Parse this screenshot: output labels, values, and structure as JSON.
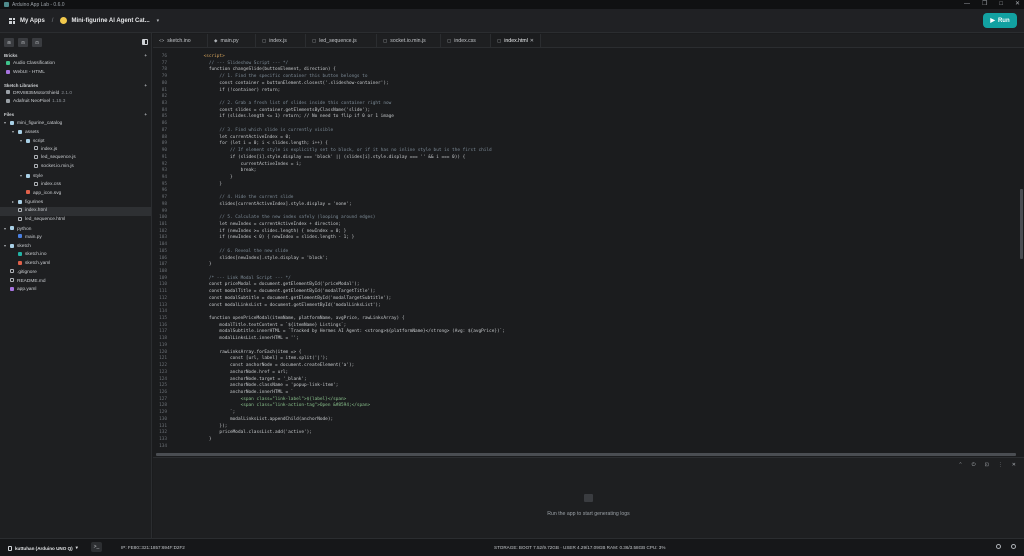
{
  "window": {
    "title": "Arduino App Lab - 0.6.0",
    "controls": [
      "—",
      "❐",
      "□",
      "✕"
    ]
  },
  "header": {
    "my_apps": "My Apps",
    "separator": "/",
    "app_name": "Mini-figurine AI Agent Cat...",
    "run_label": "Run"
  },
  "sidebar": {
    "tools": [
      "⊞",
      "⊟",
      "⊡"
    ],
    "bricks_title": "Bricks",
    "bricks": [
      "Audio Classification",
      "WebUI - HTML"
    ],
    "libs_title": "Sketch Libraries",
    "libs": [
      {
        "name": "DRV8835MotorShield",
        "version": "2.1.0"
      },
      {
        "name": "Adafruit NeoPixel",
        "version": "1.15.3"
      }
    ],
    "files_title": "Files",
    "tree": [
      {
        "label": "mini_figurine_catalog",
        "depth": 0,
        "kind": "folder",
        "arrow": "▾"
      },
      {
        "label": "assets",
        "depth": 1,
        "kind": "folder",
        "arrow": "▾"
      },
      {
        "label": "script",
        "depth": 2,
        "kind": "folder",
        "arrow": "▾"
      },
      {
        "label": "index.js",
        "depth": 3,
        "kind": "file",
        "arrow": ""
      },
      {
        "label": "led_sequence.js",
        "depth": 3,
        "kind": "file",
        "arrow": ""
      },
      {
        "label": "socket.io.min.js",
        "depth": 3,
        "kind": "file",
        "arrow": ""
      },
      {
        "label": "style",
        "depth": 2,
        "kind": "folder",
        "arrow": "▾"
      },
      {
        "label": "index.css",
        "depth": 3,
        "kind": "file",
        "arrow": ""
      },
      {
        "label": "app_icon.svg",
        "depth": 2,
        "kind": "svg",
        "arrow": ""
      },
      {
        "label": "figurines",
        "depth": 1,
        "kind": "folder",
        "arrow": "▸"
      },
      {
        "label": "index.html",
        "depth": 1,
        "kind": "file",
        "arrow": "",
        "active": true
      },
      {
        "label": "led_sequence.html",
        "depth": 1,
        "kind": "file",
        "arrow": ""
      },
      {
        "label": "python",
        "depth": 0,
        "kind": "folder",
        "arrow": "▾"
      },
      {
        "label": "main.py",
        "depth": 1,
        "kind": "py",
        "arrow": ""
      },
      {
        "label": "sketch",
        "depth": 0,
        "kind": "folder",
        "arrow": "▾"
      },
      {
        "label": "sketch.ino",
        "depth": 1,
        "kind": "ino",
        "arrow": ""
      },
      {
        "label": "sketch.yaml",
        "depth": 1,
        "kind": "yaml",
        "arrow": ""
      },
      {
        "label": ".gitignore",
        "depth": 0,
        "kind": "file",
        "arrow": ""
      },
      {
        "label": "README.md",
        "depth": 0,
        "kind": "file",
        "arrow": ""
      },
      {
        "label": "app.yaml",
        "depth": 0,
        "kind": "yaml2",
        "arrow": ""
      }
    ]
  },
  "tabs": [
    {
      "label": "sketch.ino",
      "icon": "<>"
    },
    {
      "label": "main.py",
      "icon": "◆"
    },
    {
      "label": "index.js",
      "icon": "▢"
    },
    {
      "label": "led_sequence.js",
      "icon": "▢"
    },
    {
      "label": "socket.io.min.js",
      "icon": "▢"
    },
    {
      "label": "index.css",
      "icon": "▢"
    },
    {
      "label": "index.html",
      "icon": "▢",
      "active": true,
      "close": "✕"
    }
  ],
  "editor": {
    "lines": [
      {
        "n": "76",
        "t": "    <script>",
        "k": "k"
      },
      {
        "n": "77",
        "t": "      // --- Slideshow Script --- */",
        "k": "c"
      },
      {
        "n": "78",
        "t": "      function changeSlide(buttonElement, direction) {",
        "k": ""
      },
      {
        "n": "79",
        "t": "          // 1. Find the specific container this button belongs to",
        "k": "c"
      },
      {
        "n": "80",
        "t": "          const container = buttonElement.closest('.slideshow-container');",
        "k": ""
      },
      {
        "n": "81",
        "t": "          if (!container) return;",
        "k": ""
      },
      {
        "n": "82",
        "t": "",
        "k": ""
      },
      {
        "n": "83",
        "t": "          // 2. Grab a fresh list of slides inside this container right now",
        "k": "c"
      },
      {
        "n": "84",
        "t": "          const slides = container.getElementsByClassName('slide');",
        "k": ""
      },
      {
        "n": "85",
        "t": "          if (slides.length <= 1) return; // No need to flip if 0 or 1 image",
        "k": ""
      },
      {
        "n": "86",
        "t": "",
        "k": ""
      },
      {
        "n": "87",
        "t": "          // 3. Find which slide is currently visible",
        "k": "c"
      },
      {
        "n": "88",
        "t": "          let currentActiveIndex = 0;",
        "k": ""
      },
      {
        "n": "89",
        "t": "          for (let i = 0; i < slides.length; i++) {",
        "k": ""
      },
      {
        "n": "90",
        "t": "              // If element style is explicitly set to block, or if it has no inline style but is the first child",
        "k": "c"
      },
      {
        "n": "91",
        "t": "              if (slides[i].style.display === 'block' || (slides[i].style.display === '' && i === 0)) {",
        "k": ""
      },
      {
        "n": "92",
        "t": "                  currentActiveIndex = i;",
        "k": ""
      },
      {
        "n": "93",
        "t": "                  break;",
        "k": ""
      },
      {
        "n": "94",
        "t": "              }",
        "k": ""
      },
      {
        "n": "95",
        "t": "          }",
        "k": ""
      },
      {
        "n": "96",
        "t": "",
        "k": ""
      },
      {
        "n": "97",
        "t": "          // 4. Hide the current slide",
        "k": "c"
      },
      {
        "n": "98",
        "t": "          slides[currentActiveIndex].style.display = 'none';",
        "k": ""
      },
      {
        "n": "99",
        "t": "",
        "k": ""
      },
      {
        "n": "100",
        "t": "          // 5. Calculate the new index safely (looping around edges)",
        "k": "c"
      },
      {
        "n": "101",
        "t": "          let newIndex = currentActiveIndex + direction;",
        "k": ""
      },
      {
        "n": "102",
        "t": "          if (newIndex >= slides.length) { newIndex = 0; }",
        "k": ""
      },
      {
        "n": "103",
        "t": "          if (newIndex < 0) { newIndex = slides.length - 1; }",
        "k": ""
      },
      {
        "n": "104",
        "t": "",
        "k": ""
      },
      {
        "n": "105",
        "t": "          // 6. Reveal the new slide",
        "k": "c"
      },
      {
        "n": "106",
        "t": "          slides[newIndex].style.display = 'block';",
        "k": ""
      },
      {
        "n": "107",
        "t": "      }",
        "k": ""
      },
      {
        "n": "108",
        "t": "",
        "k": ""
      },
      {
        "n": "109",
        "t": "      /* --- Link Modal Script --- */",
        "k": "c"
      },
      {
        "n": "110",
        "t": "      const priceModal = document.getElementById('priceModal');",
        "k": ""
      },
      {
        "n": "111",
        "t": "      const modalTitle = document.getElementById('modalTargetTitle');",
        "k": ""
      },
      {
        "n": "112",
        "t": "      const modalSubtitle = document.getElementById('modalTargetSubtitle');",
        "k": ""
      },
      {
        "n": "113",
        "t": "      const modalLinksList = document.getElementById('modalLinksList');",
        "k": ""
      },
      {
        "n": "114",
        "t": "",
        "k": ""
      },
      {
        "n": "115",
        "t": "      function openPriceModal(itemName, platformName, avgPrice, rawLinksArray) {",
        "k": ""
      },
      {
        "n": "116",
        "t": "          modalTitle.textContent = `${itemName} Listings`;",
        "k": ""
      },
      {
        "n": "117",
        "t": "          modalSubtitle.innerHTML = `Tracked by Hermes AI Agent: <strong>${platformName}</strong> (Avg: ${avgPrice})`;",
        "k": ""
      },
      {
        "n": "118",
        "t": "          modalLinksList.innerHTML = '';",
        "k": ""
      },
      {
        "n": "119",
        "t": "",
        "k": ""
      },
      {
        "n": "120",
        "t": "          rawLinksArray.forEach(item => {",
        "k": ""
      },
      {
        "n": "121",
        "t": "              const [url, label] = item.split('|');",
        "k": ""
      },
      {
        "n": "122",
        "t": "              const anchorNode = document.createElement('a');",
        "k": ""
      },
      {
        "n": "123",
        "t": "              anchorNode.href = url;",
        "k": ""
      },
      {
        "n": "124",
        "t": "              anchorNode.target = '_blank';",
        "k": ""
      },
      {
        "n": "125",
        "t": "              anchorNode.className = 'popup-link-item';",
        "k": ""
      },
      {
        "n": "126",
        "t": "              anchorNode.innerHTML = `",
        "k": ""
      },
      {
        "n": "127",
        "t": "                  <span class=\"link-label\">${label}</span>",
        "k": "s"
      },
      {
        "n": "128",
        "t": "                  <span class=\"link-action-tag\">Open &#8594;</span>",
        "k": "s"
      },
      {
        "n": "129",
        "t": "              `;",
        "k": ""
      },
      {
        "n": "130",
        "t": "              modalLinksList.appendChild(anchorNode);",
        "k": ""
      },
      {
        "n": "131",
        "t": "          });",
        "k": ""
      },
      {
        "n": "132",
        "t": "          priceModal.classList.add('active');",
        "k": ""
      },
      {
        "n": "133",
        "t": "      }",
        "k": ""
      },
      {
        "n": "134",
        "t": "",
        "k": ""
      }
    ]
  },
  "console": {
    "controls": [
      "⌃",
      "⏻",
      "⊡",
      "⋮",
      "✕"
    ],
    "empty_message": "Run the app to start generating logs"
  },
  "status": {
    "board": "kuttuhan (Arduino UNO Q)",
    "board_caret": "▾",
    "terminal": ">_",
    "ip": "IP: FE80::321:1857:694F:D2F2",
    "stats": "STORAGE: BOOT 7.52/9.72GB · USER 4.29/17.09GB   RAM: 0.36/3.58GB   CPU: 3%"
  }
}
